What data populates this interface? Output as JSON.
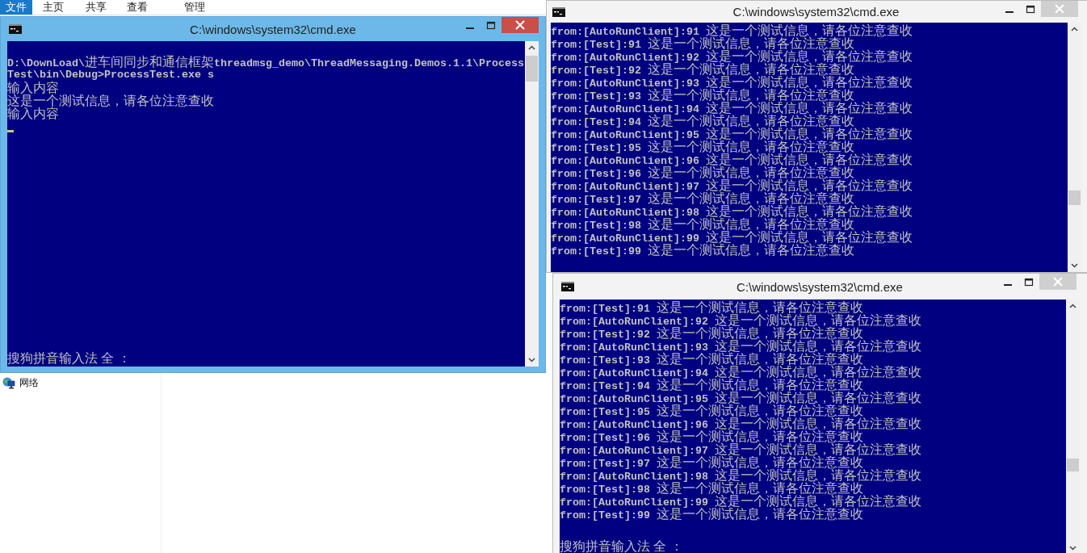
{
  "explorer": {
    "ribbon_tabs": [
      {
        "label": "文件",
        "selected": true
      },
      {
        "label": "主页",
        "selected": false
      },
      {
        "label": "共享",
        "selected": false
      },
      {
        "label": "查看",
        "selected": false
      },
      {
        "label": "管理",
        "selected": false
      }
    ],
    "nav_items": [
      {
        "label": "网络"
      }
    ]
  },
  "windows": [
    {
      "title": "C:\\windows\\system32\\cmd.exe",
      "active": true,
      "lines": [
        "D:\\DownLoad\\进车间同步和通信框架threadmsg_demo\\ThreadMessaging.Demos.1.1\\Process",
        "Test\\bin\\Debug>ProcessTest.exe s",
        "输入内容",
        "这是一个测试信息，请各位注意查收",
        "输入内容"
      ],
      "ime_status": "搜狗拼音输入法 全 ："
    },
    {
      "title": "C:\\windows\\system32\\cmd.exe",
      "active": false,
      "lines": [
        "from:[AutoRunClient]:91 这是一个测试信息，请各位注意查收",
        "from:[Test]:91 这是一个测试信息，请各位注意查收",
        "from:[AutoRunClient]:92 这是一个测试信息，请各位注意查收",
        "from:[Test]:92 这是一个测试信息，请各位注意查收",
        "from:[AutoRunClient]:93 这是一个测试信息，请各位注意查收",
        "from:[Test]:93 这是一个测试信息，请各位注意查收",
        "from:[AutoRunClient]:94 这是一个测试信息，请各位注意查收",
        "from:[Test]:94 这是一个测试信息，请各位注意查收",
        "from:[AutoRunClient]:95 这是一个测试信息，请各位注意查收",
        "from:[Test]:95 这是一个测试信息，请各位注意查收",
        "from:[AutoRunClient]:96 这是一个测试信息，请各位注意查收",
        "from:[Test]:96 这是一个测试信息，请各位注意查收",
        "from:[AutoRunClient]:97 这是一个测试信息，请各位注意查收",
        "from:[Test]:97 这是一个测试信息，请各位注意查收",
        "from:[AutoRunClient]:98 这是一个测试信息，请各位注意查收",
        "from:[Test]:98 这是一个测试信息，请各位注意查收",
        "from:[AutoRunClient]:99 这是一个测试信息，请各位注意查收",
        "from:[Test]:99 这是一个测试信息，请各位注意查收"
      ]
    },
    {
      "title": "C:\\windows\\system32\\cmd.exe",
      "active": false,
      "lines": [
        "from:[Test]:91 这是一个测试信息，请各位注意查收",
        "from:[AutoRunClient]:92 这是一个测试信息，请各位注意查收",
        "from:[Test]:92 这是一个测试信息，请各位注意查收",
        "from:[AutoRunClient]:93 这是一个测试信息，请各位注意查收",
        "from:[Test]:93 这是一个测试信息，请各位注意查收",
        "from:[AutoRunClient]:94 这是一个测试信息，请各位注意查收",
        "from:[Test]:94 这是一个测试信息，请各位注意查收",
        "from:[AutoRunClient]:95 这是一个测试信息，请各位注意查收",
        "from:[Test]:95 这是一个测试信息，请各位注意查收",
        "from:[AutoRunClient]:96 这是一个测试信息，请各位注意查收",
        "from:[Test]:96 这是一个测试信息，请各位注意查收",
        "from:[AutoRunClient]:97 这是一个测试信息，请各位注意查收",
        "from:[Test]:97 这是一个测试信息，请各位注意查收",
        "from:[AutoRunClient]:98 这是一个测试信息，请各位注意查收",
        "from:[Test]:98 这是一个测试信息，请各位注意查收",
        "from:[AutoRunClient]:99 这是一个测试信息，请各位注意查收",
        "from:[Test]:99 这是一个测试信息，请各位注意查收"
      ],
      "ime_status": "搜狗拼音输入法 全 ："
    }
  ]
}
